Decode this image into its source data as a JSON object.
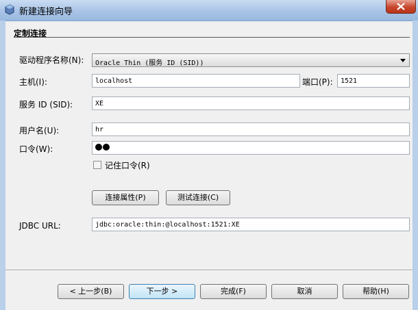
{
  "window": {
    "title": "新建连接向导"
  },
  "section": {
    "title": "定制连接"
  },
  "form": {
    "driver_label": "驱动程序名称(N):",
    "driver_value": "Oracle Thin (服务 ID (SID))",
    "host_label": "主机(I):",
    "host_value": "localhost",
    "port_label": "端口(P):",
    "port_value": "1521",
    "sid_label": "服务 ID (SID):",
    "sid_value": "XE",
    "user_label": "用户名(U):",
    "user_value": "hr",
    "password_label": "口令(W):",
    "password_mask_count": 2,
    "remember_label": "记住口令(R)",
    "remember_checked": false,
    "conn_props_button": "连接属性(P)",
    "test_conn_button": "测试连接(C)",
    "jdbc_label": "JDBC URL:",
    "jdbc_value": "jdbc:oracle:thin:@localhost:1521:XE"
  },
  "footer": {
    "back_button": "< 上一步(B)",
    "next_button": "下一步 >",
    "finish_button": "完成(F)",
    "cancel_button": "取消",
    "help_button": "帮助(H)"
  },
  "colors": {
    "title_bar": "#a9c4e6",
    "close_button": "#c7462c",
    "primary_button": "#c2e4f6"
  }
}
